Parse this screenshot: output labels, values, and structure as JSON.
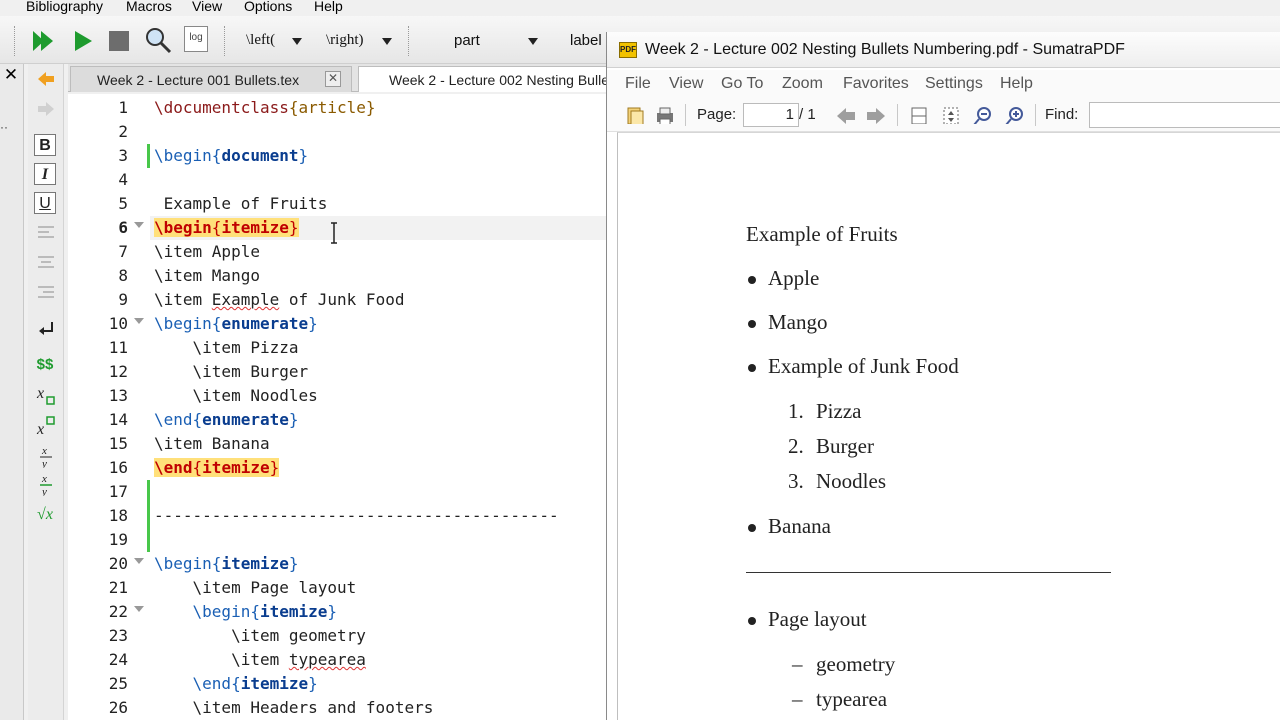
{
  "texstudio": {
    "menu": [
      "Bibliography",
      "Macros",
      "View",
      "Options",
      "Help"
    ],
    "toolbar": {
      "left_combo": "\\left(",
      "right_combo": "\\right)",
      "section_combo": "part",
      "label_combo": "label",
      "log_label": "log"
    },
    "close_label": "✕",
    "tabs": [
      {
        "title": "Week 2 - Lecture 001 Bullets.tex",
        "close": "✕"
      },
      {
        "title": "Week 2 - Lecture 002 Nesting Bulle"
      }
    ],
    "sidebar_buttons": {
      "bold": "B",
      "italic": "I",
      "underline": "U",
      "math": "$$",
      "sqrt": "√x"
    },
    "line_numbers": [
      "1",
      "2",
      "3",
      "4",
      "5",
      "6",
      "7",
      "8",
      "9",
      "10",
      "11",
      "12",
      "13",
      "14",
      "15",
      "16",
      "17",
      "18",
      "19",
      "20",
      "21",
      "22",
      "23",
      "24",
      "25",
      "26"
    ],
    "code": {
      "l1_cmd": "\\documentclass",
      "l1_arg": "{article}",
      "l3_cmd": "\\begin",
      "l3_arg": "document",
      "l5": " Example of Fruits",
      "l6_cmd": "\\begin",
      "l6_arg": "itemize",
      "l7": "\\item Apple",
      "l8": "\\item Mango",
      "l9_a": "\\item ",
      "l9_b": "Example",
      "l9_c": " of Junk Food",
      "l10_cmd": "\\begin",
      "l10_arg": "enumerate",
      "l11": "    \\item Pizza",
      "l12": "    \\item Burger",
      "l13": "    \\item Noodles",
      "l14_cmd": "\\end",
      "l14_arg": "enumerate",
      "l15": "\\item Banana",
      "l16_cmd": "\\end",
      "l16_arg": "itemize",
      "l18": "------------------------------------------",
      "l20_cmd": "\\begin",
      "l20_arg": "itemize",
      "l21": "    \\item Page layout",
      "l22_cmd": "    \\begin",
      "l22_arg": "itemize",
      "l23": "        \\item geometry",
      "l24_a": "        \\item ",
      "l24_b": "typearea",
      "l25_cmd": "    \\end",
      "l25_arg": "itemize",
      "l26": "    \\item Headers and footers"
    }
  },
  "sumatra": {
    "title": "Week 2 - Lecture 002 Nesting Bullets Numbering.pdf - SumatraPDF",
    "icon_text": "PDF",
    "menu": [
      "File",
      "View",
      "Go To",
      "Zoom",
      "Favorites",
      "Settings",
      "Help"
    ],
    "page_label": "Page:",
    "page_value": "1",
    "page_total": "/ 1",
    "find_label": "Find:",
    "document": {
      "heading": "Example of Fruits",
      "bullets_1": [
        "Apple",
        "Mango",
        "Example of Junk Food"
      ],
      "numbered": [
        {
          "num": "1.",
          "text": "Pizza"
        },
        {
          "num": "2.",
          "text": "Burger"
        },
        {
          "num": "3.",
          "text": "Noodles"
        }
      ],
      "bullet_after": "Banana",
      "bullets_2": [
        "Page layout"
      ],
      "dash_items": [
        {
          "dash": "–",
          "text": "geometry"
        },
        {
          "dash": "–",
          "text": "typearea"
        }
      ]
    }
  },
  "colors": {
    "keyword": "#1a5fb4",
    "env_highlight": "#ffe07a",
    "env_text": "#c00000",
    "change_marker": "#48c74a"
  }
}
